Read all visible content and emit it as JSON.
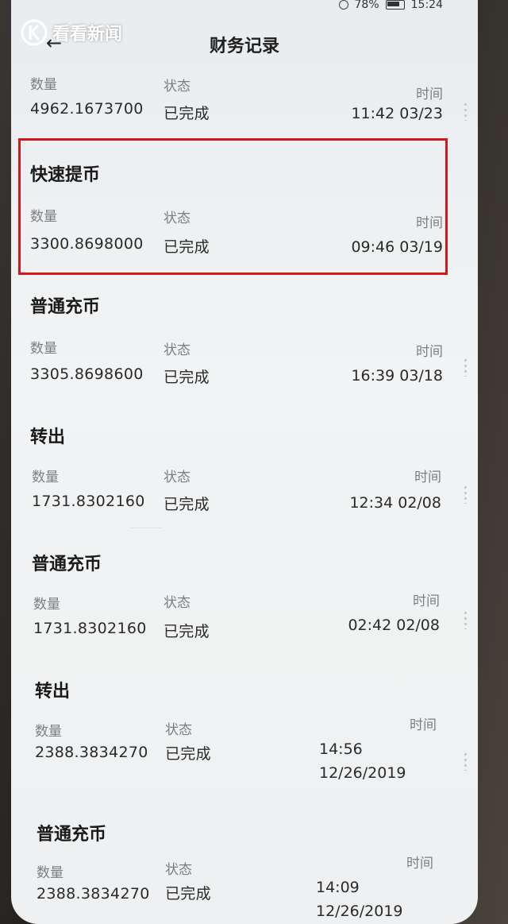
{
  "status_bar": {
    "battery": "78%",
    "clock": "15:24"
  },
  "watermark": {
    "text": "看看新闻"
  },
  "header": {
    "back_icon": "←",
    "title": "财务记录"
  },
  "labels": {
    "amount": "数量",
    "status": "状态",
    "time": "时间"
  },
  "records": [
    {
      "type": "",
      "amount": "4962.1673700",
      "status": "已完成",
      "time": "11:42 03/23"
    },
    {
      "type": "快速提币",
      "amount": "3300.8698000",
      "status": "已完成",
      "time": "09:46 03/19"
    },
    {
      "type": "普通充币",
      "amount": "3305.8698600",
      "status": "已完成",
      "time": "16:39 03/18"
    },
    {
      "type": "转出",
      "amount": "1731.8302160",
      "status": "已完成",
      "time": "12:34 02/08"
    },
    {
      "type": "普通充币",
      "amount": "1731.8302160",
      "status": "已完成",
      "time": "02:42 02/08"
    },
    {
      "type": "转出",
      "amount": "2388.3834270",
      "status": "已完成",
      "time_line1": "14:56",
      "time_line2": "12/26/2019"
    },
    {
      "type": "普通充币",
      "amount": "2388.3834270",
      "status": "已完成",
      "time_line1": "14:09",
      "time_line2": "12/26/2019"
    }
  ],
  "colors": {
    "highlight_border": "#d4161d",
    "screen_bg": "#eef0f1",
    "label_gray": "#7b7f84"
  }
}
